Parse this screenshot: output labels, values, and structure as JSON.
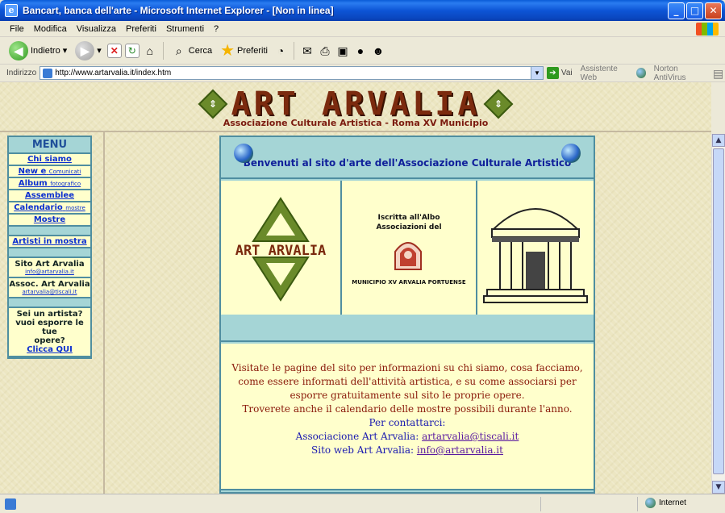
{
  "window": {
    "title": "Bancart, banca dell'arte - Microsoft Internet Explorer - [Non in linea]",
    "min": "_",
    "max": "□",
    "close": "✕"
  },
  "menubar": [
    "File",
    "Modifica",
    "Visualizza",
    "Preferiti",
    "Strumenti",
    "?"
  ],
  "toolbar": {
    "back_label": "Indietro",
    "search_label": "Cerca",
    "favorites_label": "Preferiti"
  },
  "addressbar": {
    "label": "Indirizzo",
    "url": "http://www.artarvalia.it/index.htm",
    "go_label": "Vai",
    "assistant_label": "Assistente Web",
    "norton_label": "Norton AntiVirus"
  },
  "header": {
    "logo_text": "ART ARVALIA",
    "subtitle": "Associazione Culturale Artistica - Roma XV Municipio"
  },
  "menu": {
    "title": "MENU",
    "items": [
      {
        "label": "Chi siamo",
        "small": ""
      },
      {
        "label": "New e",
        "small": "Comunicati"
      },
      {
        "label": "Album",
        "small": "fotografico"
      },
      {
        "label": "Assemblee",
        "small": ""
      },
      {
        "label": "Calendario",
        "small": "mostre"
      },
      {
        "label": "Mostre",
        "small": ""
      }
    ],
    "artists": "Artisti in mostra",
    "site_title": "Sito Art Arvalia",
    "site_email": "info@artarvalia.it",
    "assoc_title": "Assoc. Art Arvalia",
    "assoc_email": "artarvalia@tiscali.it",
    "artist_q1": "Sei un artista?",
    "artist_q2": "vuoi esporre le tue",
    "artist_q3": "opere?",
    "artist_link": "Clicca QUI"
  },
  "content": {
    "welcome": "Benvenuti al sito d'arte dell'Associazione Culturale Artistico",
    "cell1_logo": "ART ARVALIA",
    "albo_line1": "Iscritta all'Albo",
    "albo_line2": "Associazioni del",
    "municipio": "MUNICIPIO XV ARVALIA PORTUENSE",
    "lines": [
      "Visitate le pagine del sito per informazioni su chi siamo, cosa facciamo,",
      "come essere informati  dell'attività artistica, e su come associarsi per",
      "esporre gratuitamente sul sito le proprie opere.",
      "Troverete anche il calendario delle mostre possibili durante l'anno."
    ],
    "contact_title": "Per contattarci:",
    "assoc_label": "Associacione Art Arvalia:",
    "assoc_email": "artarvalia@tiscali.it",
    "web_label": "Sito web Art Arvalia:",
    "web_email": "info@artarvalia.it"
  },
  "status": {
    "zone": "Internet"
  }
}
